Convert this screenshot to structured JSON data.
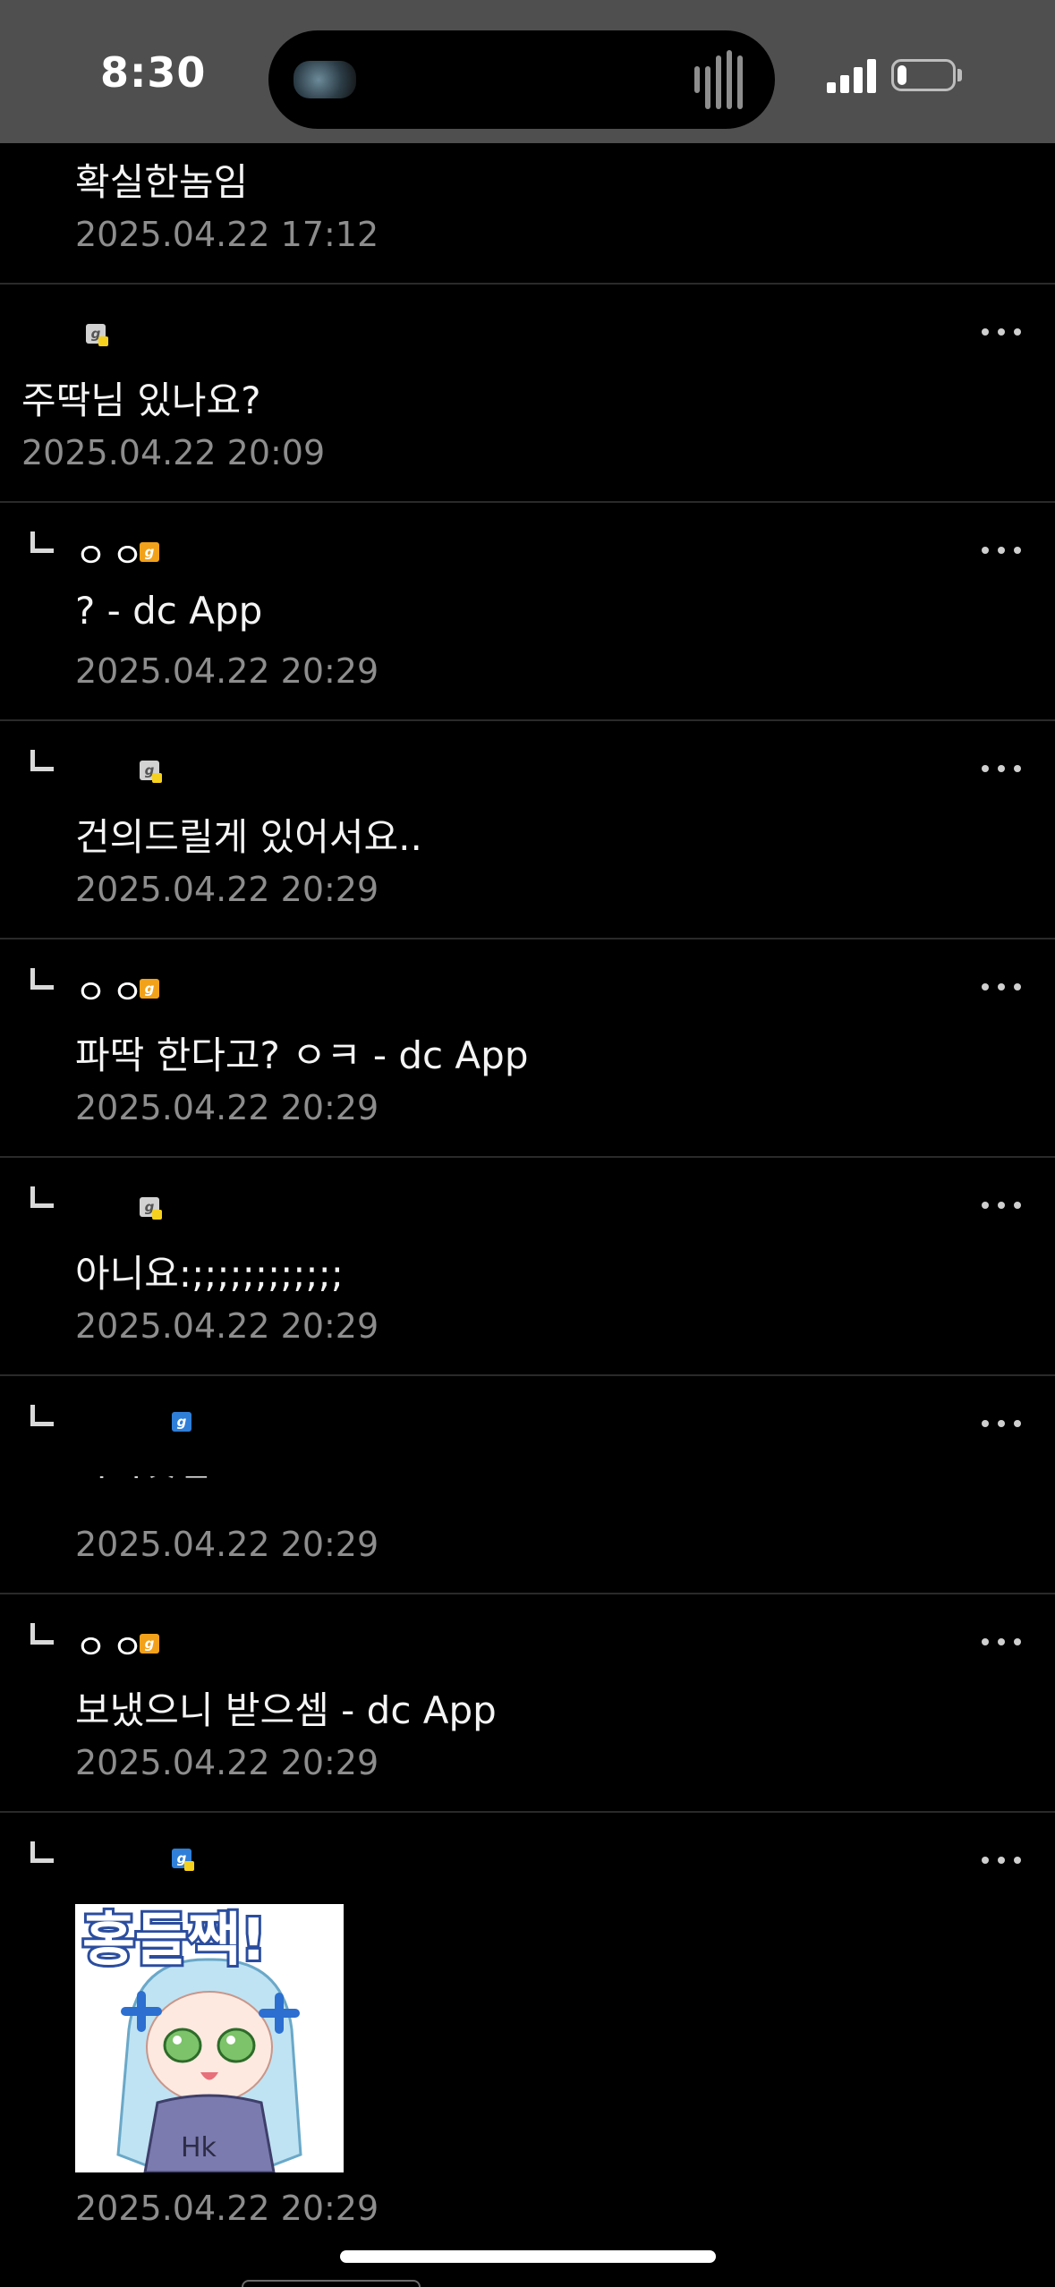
{
  "status_bar": {
    "time": "8:30",
    "signal_icon": "cellular-signal-icon",
    "battery_icon": "battery-icon",
    "battery_level": 0.18
  },
  "comments": [
    {
      "is_reply": false,
      "nickname": "",
      "text": "확실한놈임",
      "date": "2025.04.22 17:12"
    },
    {
      "is_reply": false,
      "nickname": "",
      "text": "주딱님 있나요?",
      "date": "2025.04.22 20:09"
    },
    {
      "is_reply": true,
      "nickname": "ㅇㅇ",
      "text": "? - dc App",
      "date": "2025.04.22 20:29"
    },
    {
      "is_reply": true,
      "nickname": "",
      "text": "건의드릴게 있어서요..",
      "date": "2025.04.22 20:29"
    },
    {
      "is_reply": true,
      "nickname": "ㅇㅇ",
      "text": "파딱 한다고? ㅇㅋ - dc App",
      "date": "2025.04.22 20:29"
    },
    {
      "is_reply": true,
      "nickname": "",
      "text": "아니요:;;;;;;;;;;;;",
      "date": "2025.04.22 20:29"
    },
    {
      "is_reply": true,
      "nickname": "",
      "text": "ㅋㅋㅅㅂ",
      "date": "2025.04.22 20:29"
    },
    {
      "is_reply": true,
      "nickname": "ㅇㅇ",
      "text": "보냈으니 받으셈 - dc App",
      "date": "2025.04.22 20:29"
    },
    {
      "is_reply": true,
      "nickname": "",
      "sticker": {
        "caption": "홍들짹!",
        "shirt_text": "Hk"
      },
      "date": "2025.04.22 20:29"
    }
  ],
  "icons": {
    "more": "more-options-icon",
    "reply": "reply-arrow-icon",
    "badge": "member-badge-icon"
  },
  "colors": {
    "background": "#000000",
    "status_bar": "#4f4f4f",
    "text": "#f4f4f4",
    "date": "#8d8d8d",
    "divider": "#2a2a2a",
    "badge_orange": "#f2a11a",
    "badge_blue": "#2f7fd8"
  }
}
